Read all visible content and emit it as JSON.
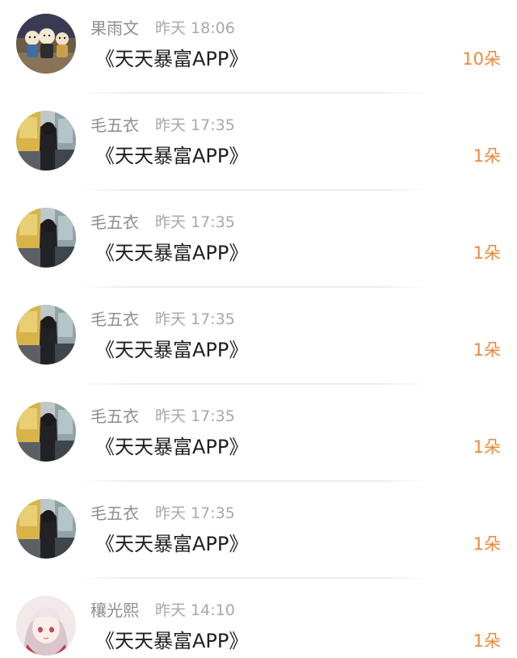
{
  "colors": {
    "name": "#8e8e8e",
    "time": "#a8a8a8",
    "message": "#1f1f1f",
    "gift": "#f0883a",
    "background": "#ffffff"
  },
  "messages": [
    {
      "name": "果雨文",
      "time": "昨天 18:06",
      "text": "《天天暴富APP》",
      "gift": "10朵",
      "avatar": "figurines-avatar"
    },
    {
      "name": "毛五衣",
      "time": "昨天 17:35",
      "text": "《天天暴富APP》",
      "gift": "1朵",
      "avatar": "bus-window-avatar"
    },
    {
      "name": "毛五衣",
      "time": "昨天 17:35",
      "text": "《天天暴富APP》",
      "gift": "1朵",
      "avatar": "bus-window-avatar"
    },
    {
      "name": "毛五衣",
      "time": "昨天 17:35",
      "text": "《天天暴富APP》",
      "gift": "1朵",
      "avatar": "bus-window-avatar"
    },
    {
      "name": "毛五衣",
      "time": "昨天 17:35",
      "text": "《天天暴富APP》",
      "gift": "1朵",
      "avatar": "bus-window-avatar"
    },
    {
      "name": "毛五衣",
      "time": "昨天 17:35",
      "text": "《天天暴富APP》",
      "gift": "1朵",
      "avatar": "bus-window-avatar"
    },
    {
      "name": "穰光熙",
      "time": "昨天 14:10",
      "text": "《天天暴富APP》",
      "gift": "1朵",
      "avatar": "anime-girl-avatar"
    }
  ]
}
